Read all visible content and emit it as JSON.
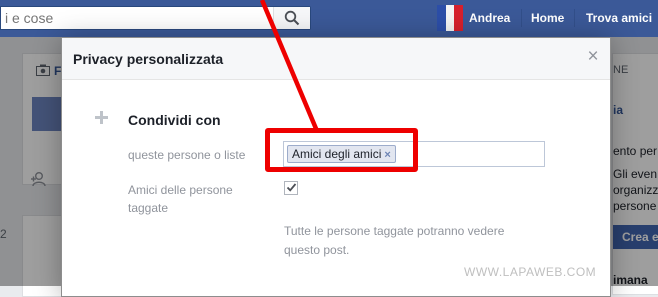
{
  "topbar": {
    "search": {
      "value": "",
      "placeholder": "i e cose"
    },
    "user_name": "Andrea",
    "home_label": "Home",
    "find_friends_label": "Trova amici"
  },
  "background": {
    "left_letter": "F",
    "right_header": "NE",
    "right_link": "ia",
    "right_text_1": "ento per l",
    "right_text_2": "Gli even",
    "right_text_3": "organizz",
    "right_text_4": "persone",
    "crea_button": "Crea e",
    "right_text_5": "imana",
    "left_num": "2"
  },
  "dialog": {
    "title": "Privacy personalizzata",
    "close_symbol": "×",
    "section_title": "Condividi con",
    "share_label": "queste persone o liste",
    "token_label": "Amici degli amici",
    "token_remove": "×",
    "tagged_label_line1": "Amici delle persone",
    "tagged_label_line2": "taggate",
    "tagged_checked": true,
    "help_line1": "Tutte le persone taggate potranno vedere",
    "help_line2": "questo post."
  },
  "watermark": "WWW.LAPAWEB.COM",
  "colors": {
    "topbar": "#3b5998",
    "annotation": "#ee0000",
    "token_bg": "#e2e6f0"
  }
}
